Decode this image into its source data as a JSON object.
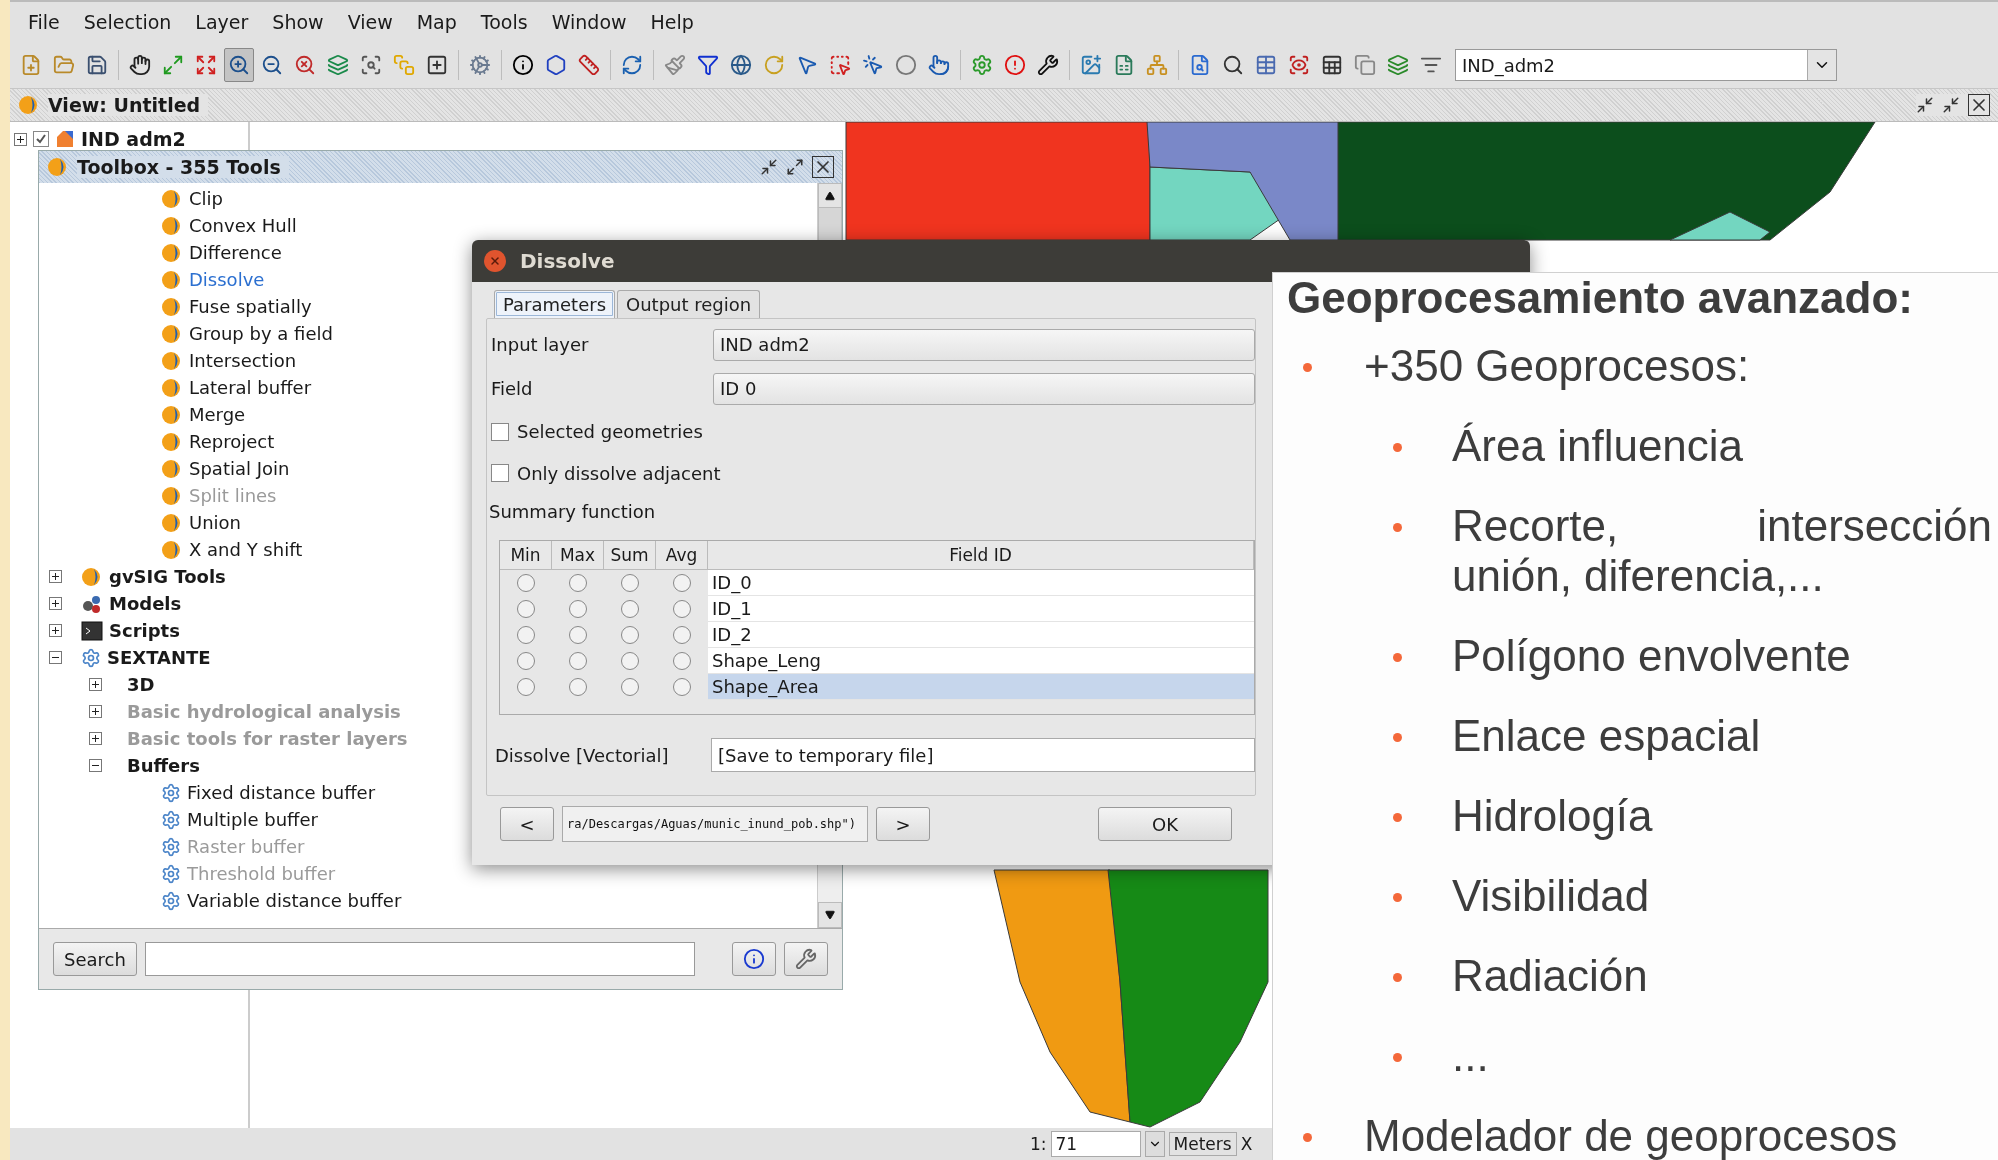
{
  "menu": [
    "File",
    "Selection",
    "Layer",
    "Show",
    "View",
    "Map",
    "Tools",
    "Window",
    "Help"
  ],
  "toolbar": {
    "tools": [
      {
        "kind": "new",
        "selected": false
      },
      {
        "kind": "open",
        "selected": false
      },
      {
        "kind": "save",
        "selected": false
      },
      {
        "kind": "pan",
        "selected": false
      },
      {
        "kind": "zoom-all",
        "selected": false
      },
      {
        "kind": "zoom-full",
        "selected": false
      },
      {
        "kind": "zoom-in",
        "selected": true
      },
      {
        "kind": "zoom-out",
        "selected": false
      },
      {
        "kind": "zoom-previous",
        "selected": false
      },
      {
        "kind": "layers",
        "selected": false
      },
      {
        "kind": "zoom-select",
        "selected": false
      },
      {
        "kind": "locator",
        "selected": false
      },
      {
        "kind": "coordinates",
        "selected": false
      },
      {
        "kind": "run",
        "selected": false
      },
      {
        "kind": "info",
        "selected": false
      },
      {
        "kind": "polygon",
        "selected": false
      },
      {
        "kind": "measure",
        "selected": false
      },
      {
        "kind": "sync",
        "selected": false
      },
      {
        "kind": "brush",
        "selected": false
      },
      {
        "kind": "filter",
        "selected": false
      },
      {
        "kind": "globe",
        "selected": false
      },
      {
        "kind": "rotate",
        "selected": false
      },
      {
        "kind": "pointer",
        "selected": false
      },
      {
        "kind": "select-rect",
        "selected": false
      },
      {
        "kind": "select-click",
        "selected": false
      },
      {
        "kind": "ring",
        "selected": false
      },
      {
        "kind": "select-poly",
        "selected": false
      },
      {
        "kind": "gear",
        "selected": false
      },
      {
        "kind": "alert",
        "selected": false
      },
      {
        "kind": "tools",
        "selected": false
      },
      {
        "kind": "add-layer",
        "selected": false
      },
      {
        "kind": "add-table",
        "selected": false
      },
      {
        "kind": "graph",
        "selected": false
      },
      {
        "kind": "find",
        "selected": false
      },
      {
        "kind": "lens",
        "selected": false
      },
      {
        "kind": "table",
        "selected": false
      },
      {
        "kind": "zoom-rect",
        "selected": false
      },
      {
        "kind": "table-edit",
        "selected": false
      },
      {
        "kind": "copy",
        "selected": false
      },
      {
        "kind": "layers-stack",
        "selected": false
      },
      {
        "kind": "layer-select",
        "selected": false
      }
    ],
    "layer_combo": "IND_adm2"
  },
  "view": {
    "title": "View: Untitled",
    "toc": [
      {
        "label": "IND adm2",
        "checked": true,
        "expanded": false
      }
    ]
  },
  "toolbox": {
    "title": "Toolbox - 355 Tools",
    "scrolled_items": [
      {
        "label": "Clip",
        "kind": "gvsig",
        "selected": false,
        "disabled": false
      },
      {
        "label": "Convex Hull",
        "kind": "gvsig",
        "selected": false,
        "disabled": false
      },
      {
        "label": "Difference",
        "kind": "gvsig",
        "selected": false,
        "disabled": false
      },
      {
        "label": "Dissolve",
        "kind": "gvsig",
        "selected": true,
        "disabled": false
      },
      {
        "label": "Fuse spatially",
        "kind": "gvsig",
        "selected": false,
        "disabled": false
      },
      {
        "label": "Group by a field",
        "kind": "gvsig",
        "selected": false,
        "disabled": false
      },
      {
        "label": "Intersection",
        "kind": "gvsig",
        "selected": false,
        "disabled": false
      },
      {
        "label": "Lateral buffer",
        "kind": "gvsig",
        "selected": false,
        "disabled": false
      },
      {
        "label": "Merge",
        "kind": "gvsig",
        "selected": false,
        "disabled": false
      },
      {
        "label": "Reproject",
        "kind": "gvsig",
        "selected": false,
        "disabled": false
      },
      {
        "label": "Spatial Join",
        "kind": "gvsig",
        "selected": false,
        "disabled": false
      },
      {
        "label": "Split lines",
        "kind": "gvsig",
        "selected": false,
        "disabled": true
      },
      {
        "label": "Union",
        "kind": "gvsig",
        "selected": false,
        "disabled": false
      },
      {
        "label": "X and Y shift",
        "kind": "gvsig",
        "selected": false,
        "disabled": false
      }
    ],
    "tree": [
      {
        "label": "gvSIG Tools",
        "kind": "gvsig",
        "expanded": false,
        "selected": false,
        "disabled": false
      },
      {
        "label": "Models",
        "kind": "models",
        "expanded": false,
        "selected": false,
        "disabled": false
      },
      {
        "label": "Scripts",
        "kind": "scripts",
        "expanded": false,
        "selected": false,
        "disabled": false
      },
      {
        "label": "SEXTANTE",
        "kind": "sextante",
        "expanded": true,
        "selected": false,
        "disabled": false,
        "children": [
          {
            "label": "3D",
            "expanded": false,
            "selected": false,
            "disabled": false
          },
          {
            "label": "Basic hydrological analysis",
            "expanded": false,
            "selected": false,
            "disabled": true
          },
          {
            "label": "Basic tools for raster layers",
            "expanded": false,
            "selected": false,
            "disabled": true
          },
          {
            "label": "Buffers",
            "expanded": true,
            "selected": false,
            "disabled": false,
            "children": [
              {
                "label": "Fixed distance buffer",
                "kind": "sextante",
                "selected": false,
                "disabled": false
              },
              {
                "label": "Multiple buffer",
                "kind": "sextante",
                "selected": false,
                "disabled": false
              },
              {
                "label": "Raster buffer",
                "kind": "sextante",
                "selected": false,
                "disabled": true
              },
              {
                "label": "Threshold buffer",
                "kind": "sextante",
                "selected": false,
                "disabled": true
              },
              {
                "label": "Variable distance buffer",
                "kind": "sextante",
                "selected": false,
                "disabled": false
              }
            ]
          }
        ]
      }
    ],
    "search_button": "Search"
  },
  "dialog": {
    "title": "Dissolve",
    "tabs": [
      {
        "label": "Parameters",
        "selected": true
      },
      {
        "label": "Output region",
        "selected": false
      }
    ],
    "input_layer": {
      "label": "Input layer",
      "value": "IND adm2"
    },
    "field": {
      "label": "Field",
      "value": "ID 0"
    },
    "options": [
      {
        "label": "Selected geometries",
        "checked": false
      },
      {
        "label": "Only dissolve adjacent",
        "checked": false
      }
    ],
    "summary_label": "Summary function",
    "table": {
      "columns": [
        "Min",
        "Max",
        "Sum",
        "Avg",
        "Field ID"
      ],
      "rows": [
        {
          "min": false,
          "max": false,
          "sum": false,
          "avg": false,
          "field": "ID_0",
          "selected": false
        },
        {
          "min": false,
          "max": false,
          "sum": false,
          "avg": false,
          "field": "ID_1",
          "selected": false
        },
        {
          "min": false,
          "max": false,
          "sum": false,
          "avg": false,
          "field": "ID_2",
          "selected": false
        },
        {
          "min": false,
          "max": false,
          "sum": false,
          "avg": false,
          "field": "Shape_Leng",
          "selected": false
        },
        {
          "min": false,
          "max": false,
          "sum": false,
          "avg": false,
          "field": "Shape_Area",
          "selected": true
        }
      ]
    },
    "output": {
      "label": "Dissolve [Vectorial]",
      "value": "[Save to temporary file]"
    },
    "nav": {
      "previous": "<",
      "path": "ra/Descargas/Aguas/munic_inund_pob.shp\")",
      "next": ">"
    },
    "ok": "OK"
  },
  "status_bar": {
    "scale_prefix": "1:",
    "scale": "71",
    "units": "Meters",
    "coordinates": "X"
  },
  "slide": {
    "title": "Geoprocesamiento avanzado:",
    "bullets": [
      {
        "text": "+350 Geoprocesos:",
        "children": [
          {
            "text": "Área influencia"
          },
          {
            "text": "Recorte, intersección unión, diferencia,..."
          },
          {
            "text": "Polígono envolvente"
          },
          {
            "text": "Enlace espacial"
          },
          {
            "text": "Hidrología"
          },
          {
            "text": "Visibilidad"
          },
          {
            "text": "Radiación"
          },
          {
            "text": "..."
          }
        ]
      },
      {
        "text": "Modelador de geoprocesos"
      }
    ]
  }
}
